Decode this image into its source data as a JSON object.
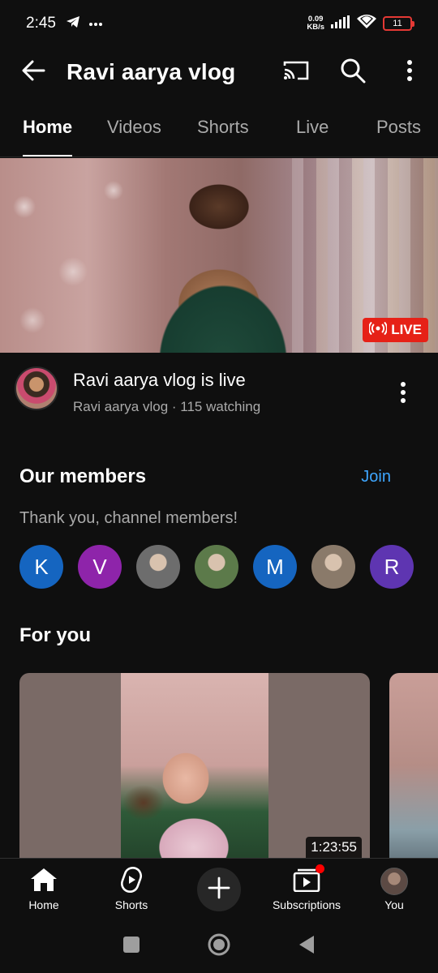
{
  "status_bar": {
    "time": "2:45",
    "net_speed_value": "0.09",
    "net_speed_unit": "KB/s",
    "battery": "11",
    "icons": [
      "telegram-icon",
      "more-dots-icon",
      "signal-icon",
      "wifi-icon",
      "battery-icon"
    ]
  },
  "app_bar": {
    "title": "Ravi aarya vlog",
    "icons": [
      "back-arrow-icon",
      "cast-icon",
      "search-icon",
      "more-vert-icon"
    ]
  },
  "tabs": [
    {
      "label": "Home",
      "active": true
    },
    {
      "label": "Videos",
      "active": false
    },
    {
      "label": "Shorts",
      "active": false
    },
    {
      "label": "Live",
      "active": false
    },
    {
      "label": "Posts",
      "active": false
    }
  ],
  "live": {
    "badge": "LIVE",
    "title": "Ravi aarya vlog is live",
    "subtitle": "Ravi aarya vlog · 115 watching"
  },
  "members": {
    "title": "Our members",
    "join": "Join",
    "subtitle": "Thank you, channel members!",
    "avatars": [
      {
        "letter": "K",
        "color": "#1565c0"
      },
      {
        "letter": "V",
        "color": "#8e24aa"
      },
      {
        "letter": "",
        "color": "#6d6d6d"
      },
      {
        "letter": "",
        "color": "#5c7a4a"
      },
      {
        "letter": "M",
        "color": "#1565c0"
      },
      {
        "letter": "",
        "color": "#8a7a6a"
      },
      {
        "letter": "R",
        "color": "#5e35b1"
      }
    ]
  },
  "for_you": {
    "title": "For you",
    "video_duration": "1:23:55"
  },
  "bottom_nav": {
    "home": "Home",
    "shorts": "Shorts",
    "subscriptions": "Subscriptions",
    "you": "You"
  }
}
